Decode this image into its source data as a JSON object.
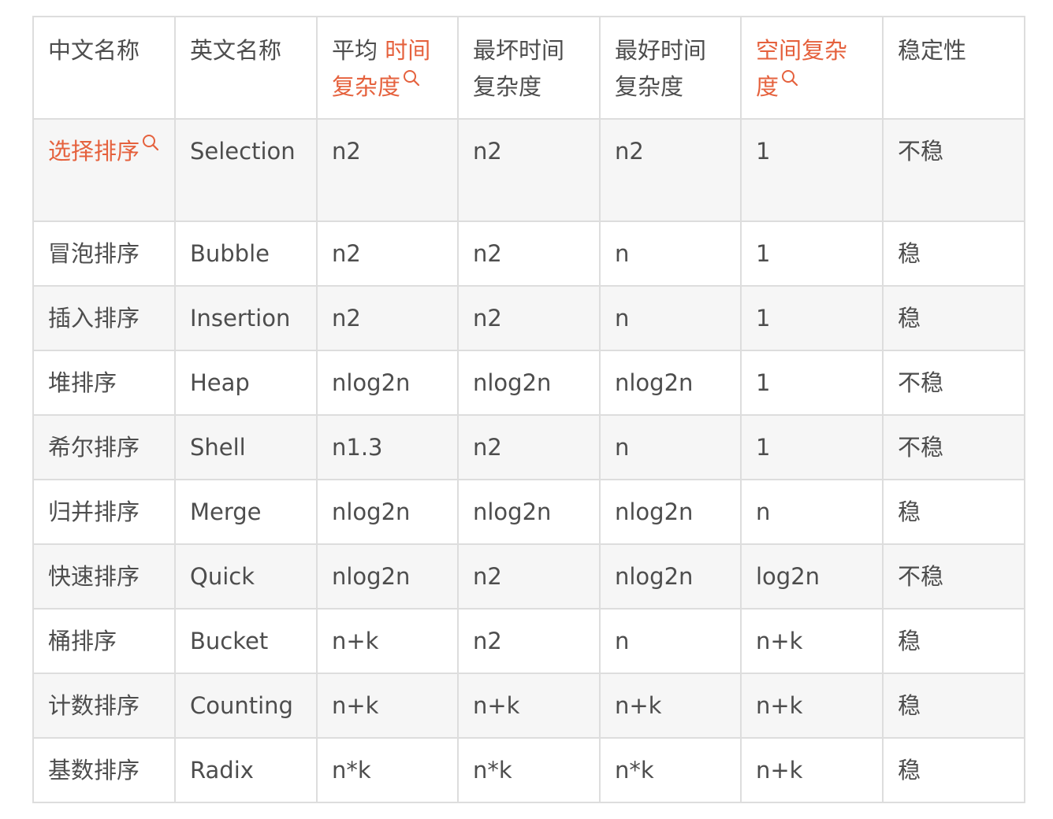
{
  "colors": {
    "link": "#e5613d",
    "text": "#4d4d4d",
    "border": "#dddddd",
    "row_alt": "#f6f6f6"
  },
  "icons": {
    "search": "search-icon"
  },
  "header": {
    "cn_name": "中文名称",
    "en_name": "英文名称",
    "avg_prefix": "平均",
    "avg_link": "时间复杂度",
    "worst": "最坏时间复杂度",
    "best": "最好时间复杂度",
    "space_link": "空间复杂度",
    "stability": "稳定性"
  },
  "rows": [
    {
      "cn": "选择排序",
      "en": "Selection",
      "avg": "n2",
      "worst": "n2",
      "best": "n2",
      "space": "1",
      "stable": "不稳"
    },
    {
      "cn": "冒泡排序",
      "en": "Bubble",
      "avg": "n2",
      "worst": "n2",
      "best": "n",
      "space": "1",
      "stable": "稳"
    },
    {
      "cn": "插入排序",
      "en": "Insertion",
      "avg": "n2",
      "worst": "n2",
      "best": "n",
      "space": "1",
      "stable": "稳"
    },
    {
      "cn": "堆排序",
      "en": "Heap",
      "avg": "nlog2n",
      "worst": "nlog2n",
      "best": "nlog2n",
      "space": "1",
      "stable": "不稳"
    },
    {
      "cn": "希尔排序",
      "en": "Shell",
      "avg": "n1.3",
      "worst": "n2",
      "best": "n",
      "space": "1",
      "stable": "不稳"
    },
    {
      "cn": "归并排序",
      "en": "Merge",
      "avg": "nlog2n",
      "worst": "nlog2n",
      "best": "nlog2n",
      "space": "n",
      "stable": "稳"
    },
    {
      "cn": "快速排序",
      "en": "Quick",
      "avg": "nlog2n",
      "worst": "n2",
      "best": "nlog2n",
      "space": "log2n",
      "stable": "不稳"
    },
    {
      "cn": "桶排序",
      "en": "Bucket",
      "avg": "n+k",
      "worst": "n2",
      "best": "n",
      "space": "n+k",
      "stable": "稳"
    },
    {
      "cn": "计数排序",
      "en": "Counting",
      "avg": "n+k",
      "worst": "n+k",
      "best": "n+k",
      "space": "n+k",
      "stable": "稳"
    },
    {
      "cn": "基数排序",
      "en": "Radix",
      "avg": "n*k",
      "worst": "n*k",
      "best": "n*k",
      "space": "n+k",
      "stable": "稳"
    }
  ]
}
